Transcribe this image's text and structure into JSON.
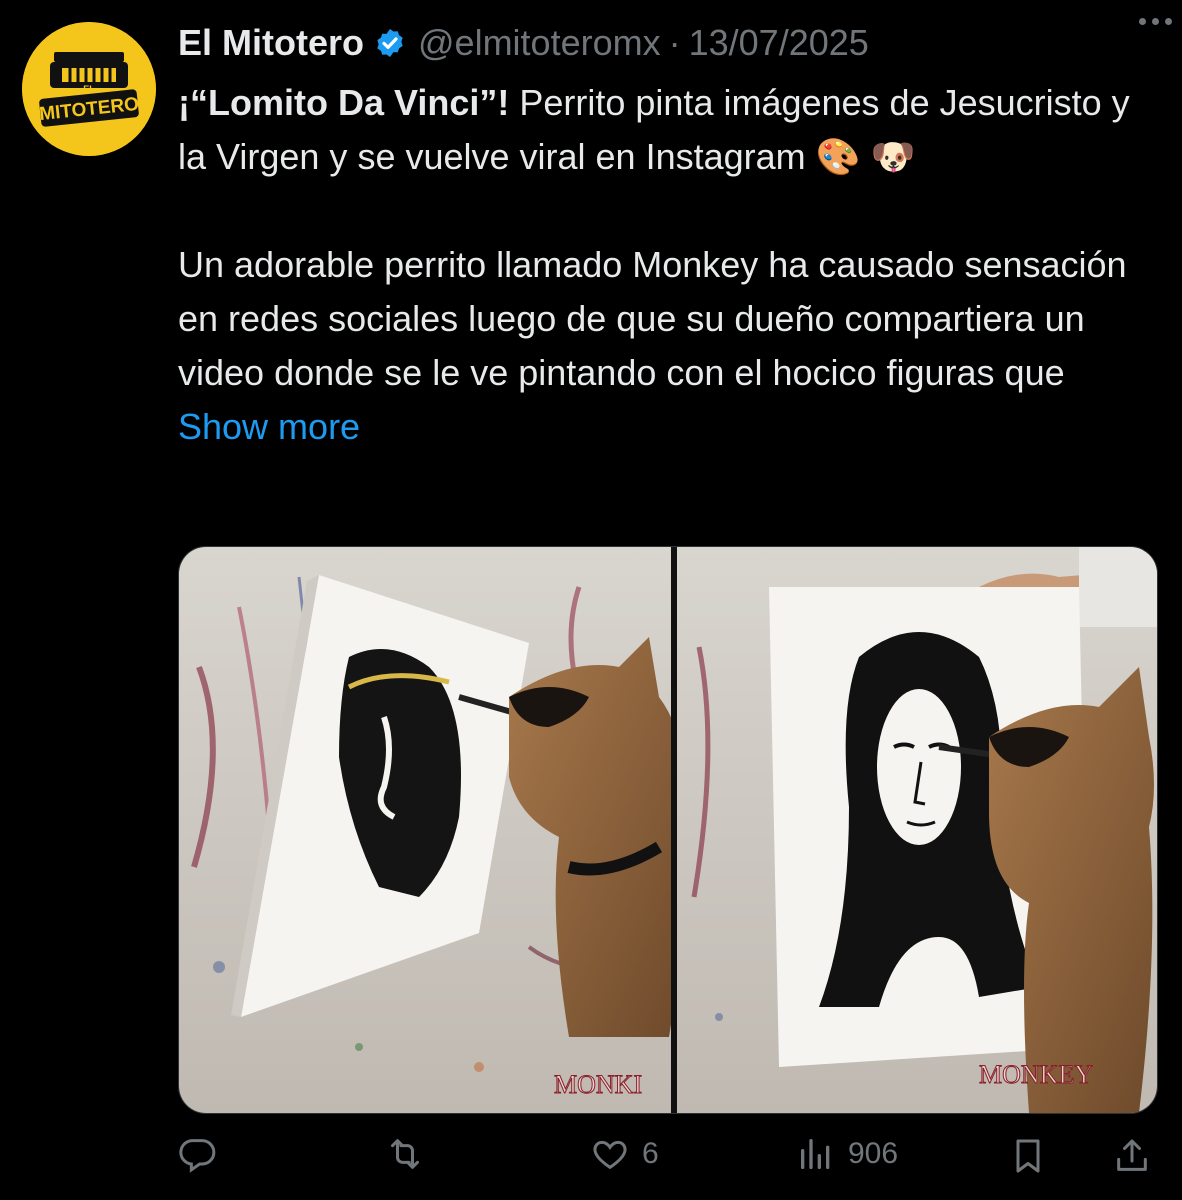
{
  "author": {
    "name": "El Mitotero",
    "handle": "@elmitoteromx",
    "separator": "·",
    "date": "13/07/2025",
    "verified": true,
    "avatar_logo_text": "MITOTERO",
    "avatar_logo_small": "EL"
  },
  "tweet": {
    "line1_bold": "¡“Lomito Da Vinci”!",
    "line1_rest": " Perrito pinta imágenes de Jesucristo y la Virgen y se vuelve viral en Instagram",
    "emoji_1": "🎨",
    "emoji_2": "🐶",
    "para2": "Un adorable perrito llamado Monkey ha causado sensación en redes sociales luego de que su dueño compartiera un video donde se le ve pintando con el hocico figuras que",
    "show_more": "Show more"
  },
  "media": {
    "left_caption": "MONKI",
    "right_caption": "MONKEY"
  },
  "actions": {
    "reply_count": "",
    "repost_count": "",
    "like_count": "6",
    "views_count": "906"
  },
  "colors": {
    "background": "#000000",
    "text": "#e7e9ea",
    "muted": "#71767b",
    "link": "#1d9bf0",
    "avatar_bg": "#f4c51b"
  },
  "icons": [
    "reply-icon",
    "repost-icon",
    "like-icon",
    "views-icon",
    "bookmark-icon",
    "share-icon",
    "verified-badge-icon",
    "more-options-icon"
  ]
}
